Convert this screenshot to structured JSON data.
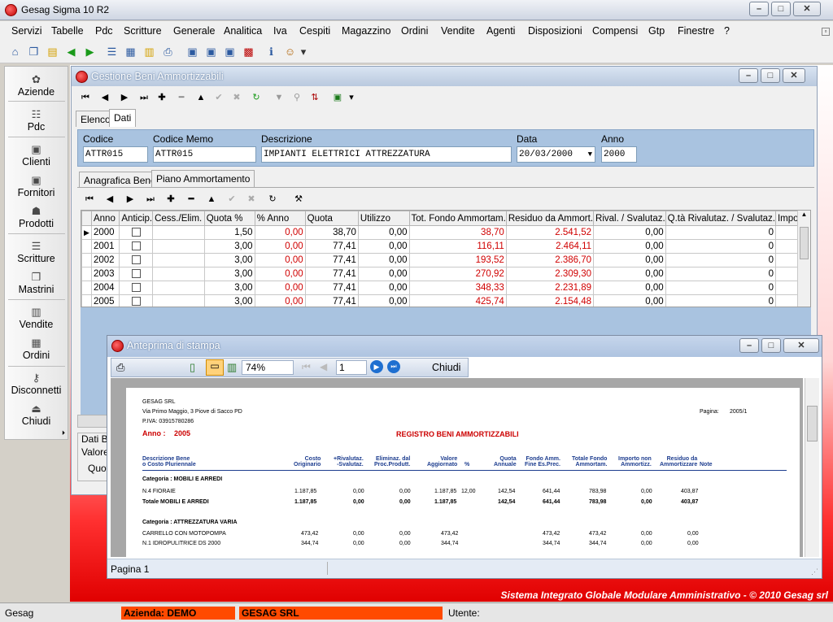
{
  "app": {
    "title": "Gesag Sigma 10 R2"
  },
  "menu": [
    "Servizi",
    "Tabelle",
    "Pdc",
    "Scritture",
    "Generale",
    "Analitica",
    "Iva",
    "Cespiti",
    "Magazzino",
    "Ordini",
    "Vendite",
    "Agenti",
    "Disposizioni",
    "Compensi",
    "Gtp",
    "Finestre",
    "?"
  ],
  "sidebar": [
    {
      "label": "Aziende",
      "icon": "flower-icon"
    },
    {
      "label": "Pdc",
      "icon": "tree-icon"
    },
    {
      "label": "Clienti",
      "icon": "user-icon"
    },
    {
      "label": "Fornitori",
      "icon": "user-icon"
    },
    {
      "label": "Prodotti",
      "icon": "users-icon"
    },
    {
      "label": "Scritture",
      "icon": "journal-icon"
    },
    {
      "label": "Mastrini",
      "icon": "ledger-icon"
    },
    {
      "label": "Vendite",
      "icon": "cart-icon"
    },
    {
      "label": "Ordini",
      "icon": "order-icon"
    },
    {
      "label": "Disconnetti",
      "icon": "key-icon"
    },
    {
      "label": "Chiudi",
      "icon": "exit-icon"
    }
  ],
  "gestione": {
    "title": "Gestione Beni Ammortizzabili",
    "tabs": [
      "Elenco",
      "Dati"
    ],
    "fields": {
      "codice_label": "Codice",
      "codice": "ATTR015",
      "memo_label": "Codice Memo",
      "memo": "ATTR015",
      "descr_label": "Descrizione",
      "descr": "IMPIANTI ELETTRICI ATTREZZATURA",
      "data_label": "Data",
      "data": "20/03/2000",
      "anno_label": "Anno",
      "anno": "2000"
    },
    "subtabs": [
      "Anagrafica Bene",
      "Piano Ammortamento"
    ],
    "grid": {
      "headers": [
        "Anno",
        "Anticip.",
        "Cess./Elim.",
        "Quota %",
        "% Anno",
        "Quota",
        "Utilizzo",
        "Tot. Fondo Ammortam.",
        "Residuo da Ammort.",
        "Rival. / Svalutaz.",
        "Q.tà Rivalutaz. / Svalutaz.",
        "Impo"
      ],
      "rows": [
        [
          "2000",
          "1,50",
          "0,00",
          "38,70",
          "0,00",
          "38,70",
          "2.541,52",
          "0,00",
          "0"
        ],
        [
          "2001",
          "3,00",
          "0,00",
          "77,41",
          "0,00",
          "116,11",
          "2.464,11",
          "0,00",
          "0"
        ],
        [
          "2002",
          "3,00",
          "0,00",
          "77,41",
          "0,00",
          "193,52",
          "2.386,70",
          "0,00",
          "0"
        ],
        [
          "2003",
          "3,00",
          "0,00",
          "77,41",
          "0,00",
          "270,92",
          "2.309,30",
          "0,00",
          "0"
        ],
        [
          "2004",
          "3,00",
          "0,00",
          "77,41",
          "0,00",
          "348,33",
          "2.231,89",
          "0,00",
          "0"
        ],
        [
          "2005",
          "3,00",
          "0,00",
          "77,41",
          "0,00",
          "425,74",
          "2.154,48",
          "0,00",
          "0"
        ]
      ]
    },
    "bottom": {
      "dati": "Dati B",
      "valore": "Valore",
      "quota": "Quot"
    }
  },
  "preview": {
    "title": "Anteprima di stampa",
    "zoom": "74%",
    "page": "1",
    "close_label": "Chiudi",
    "status": "Pagina 1",
    "report": {
      "company": "GESAG SRL",
      "address": "Via Primo Maggio, 3 Piove di Sacco PD",
      "piva": "P.IVA: 03915780286",
      "page_label": "Pagina:",
      "page_val": "2005/1",
      "anno_label": "Anno :",
      "anno": "2005",
      "title": "REGISTRO BENI AMMORTIZZABILI",
      "cols": [
        "Descrizione Bene\no Costo Pluriennale",
        "Costo\nOriginario",
        "+Rivalutaz.\n-Svalutaz.",
        "Eliminaz. dal\nProc.Produtt.",
        "Valore\nAggiornato",
        "%",
        "Quota\nAnnuale",
        "Fondo Amm.\nFine Es.Prec.",
        "Totale Fondo\nAmmortam.",
        "Importo non\nAmmortizz.",
        "Residuo da\nAmmortizzare",
        "Note"
      ],
      "cat1": "Categoria :    MOBILI E ARREDI",
      "row1": [
        "N.4 FIORAIE",
        "1.187,85",
        "0,00",
        "0,00",
        "1.187,85",
        "12,00",
        "142,54",
        "641,44",
        "783,98",
        "0,00",
        "403,87"
      ],
      "tot1": [
        "Totale    MOBILI E ARREDI",
        "1.187,85",
        "0,00",
        "0,00",
        "1.187,85",
        "",
        "142,54",
        "641,44",
        "783,98",
        "0,00",
        "403,87"
      ],
      "cat2": "Categoria :    ATTREZZATURA VARIA",
      "row2": [
        "CARRELLO CON MOTOPOMPA",
        "473,42",
        "0,00",
        "0,00",
        "473,42",
        "",
        "",
        "473,42",
        "473,42",
        "0,00",
        "0,00"
      ],
      "row3": [
        "N.1 IDROPULITRICE DS 2000",
        "344,74",
        "0,00",
        "0,00",
        "344,74",
        "",
        "",
        "344,74",
        "344,74",
        "0,00",
        "0,00"
      ]
    }
  },
  "footer": "Sistema Integrato Globale Modulare Amministrativo - © 2010 Gesag srl",
  "status": {
    "app": "Gesag",
    "azienda": "Azienda: DEMO",
    "company": "GESAG SRL",
    "utente": "Utente:"
  },
  "colors": {
    "accent": "#ff4a00",
    "title_grad": "#d9e4f2",
    "panel": "#a9c3e0",
    "red_value": "#d00000"
  }
}
